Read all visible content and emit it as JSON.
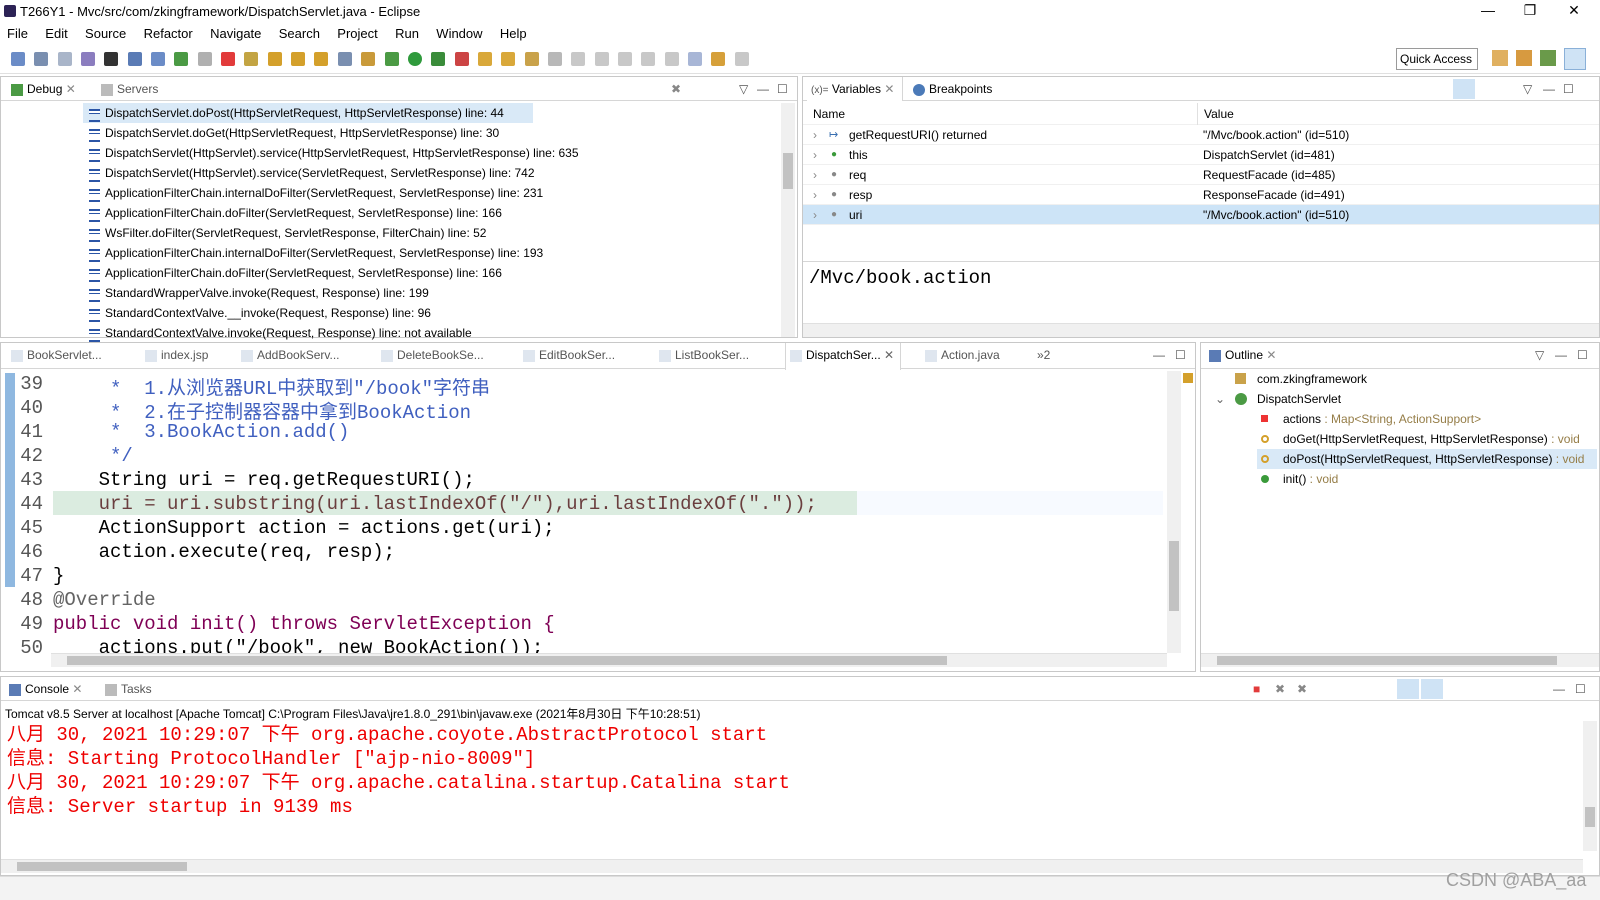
{
  "window": {
    "title": "T266Y1 - Mvc/src/com/zkingframework/DispatchServlet.java - Eclipse"
  },
  "menu": [
    "File",
    "Edit",
    "Source",
    "Refactor",
    "Navigate",
    "Search",
    "Project",
    "Run",
    "Window",
    "Help"
  ],
  "quick_access": "Quick Access",
  "debug": {
    "tabs": [
      "Debug",
      "Servers"
    ],
    "stack": [
      "DispatchServlet.doPost(HttpServletRequest, HttpServletResponse) line: 44",
      "DispatchServlet.doGet(HttpServletRequest, HttpServletResponse) line: 30",
      "DispatchServlet(HttpServlet).service(HttpServletRequest, HttpServletResponse) line: 635",
      "DispatchServlet(HttpServlet).service(ServletRequest, ServletResponse) line: 742",
      "ApplicationFilterChain.internalDoFilter(ServletRequest, ServletResponse) line: 231",
      "ApplicationFilterChain.doFilter(ServletRequest, ServletResponse) line: 166",
      "WsFilter.doFilter(ServletRequest, ServletResponse, FilterChain) line: 52",
      "ApplicationFilterChain.internalDoFilter(ServletRequest, ServletResponse) line: 193",
      "ApplicationFilterChain.doFilter(ServletRequest, ServletResponse) line: 166",
      "StandardWrapperValve.invoke(Request, Response) line: 199",
      "StandardContextValve.__invoke(Request, Response) line: 96",
      "StandardContextValve.invoke(Request, Response) line: not available"
    ]
  },
  "variables": {
    "tabs": [
      "Variables",
      "Breakpoints"
    ],
    "headers": [
      "Name",
      "Value"
    ],
    "rows": [
      {
        "name": "getRequestURI() returned",
        "value": "\"/Mvc/book.action\" (id=510)"
      },
      {
        "name": "this",
        "value": "DispatchServlet  (id=481)"
      },
      {
        "name": "req",
        "value": "RequestFacade  (id=485)"
      },
      {
        "name": "resp",
        "value": "ResponseFacade  (id=491)"
      },
      {
        "name": "uri",
        "value": "\"/Mvc/book.action\" (id=510)"
      }
    ],
    "detail": "/Mvc/book.action"
  },
  "editor": {
    "tabs": [
      "BookServlet...",
      "index.jsp",
      "AddBookServ...",
      "DeleteBookSe...",
      "EditBookSer...",
      "ListBookSer...",
      "DispatchSer...",
      "Action.java"
    ],
    "overflow": "»2",
    "lines": [
      {
        "n": "39",
        "t": "     *  1.从浏览器URL中获取到\"/book\"字符串"
      },
      {
        "n": "40",
        "t": "     *  2.在子控制器容器中拿到BookAction"
      },
      {
        "n": "41",
        "t": "     *  3.BookAction.add()"
      },
      {
        "n": "42",
        "t": "     */"
      },
      {
        "n": "43",
        "t": "    String uri = req.getRequestURI();"
      },
      {
        "n": "44",
        "t": "    uri = uri.substring(uri.lastIndexOf(\"/\"),uri.lastIndexOf(\".\"));"
      },
      {
        "n": "45",
        "t": "    ActionSupport action = actions.get(uri);"
      },
      {
        "n": "46",
        "t": "    action.execute(req, resp);"
      },
      {
        "n": "47",
        "t": "}"
      },
      {
        "n": "48",
        "t": "@Override"
      },
      {
        "n": "49",
        "t": "public void init() throws ServletException {"
      },
      {
        "n": "50",
        "t": "    actions.put(\"/book\", new BookAction());"
      }
    ]
  },
  "outline": {
    "tab": "Outline",
    "items": [
      {
        "label": "com.zkingframework",
        "suffix": ""
      },
      {
        "label": "DispatchServlet",
        "suffix": ""
      },
      {
        "label": "actions",
        "suffix": " : Map<String, ActionSupport>"
      },
      {
        "label": "doGet(HttpServletRequest, HttpServletResponse)",
        "suffix": " : void"
      },
      {
        "label": "doPost(HttpServletRequest, HttpServletResponse)",
        "suffix": " : void"
      },
      {
        "label": "init()",
        "suffix": " : void"
      }
    ]
  },
  "console": {
    "tabs": [
      "Console",
      "Tasks"
    ],
    "header": "Tomcat v8.5 Server at localhost [Apache Tomcat] C:\\Program Files\\Java\\jre1.8.0_291\\bin\\javaw.exe (2021年8月30日 下午10:28:51)",
    "lines": [
      "八月 30, 2021 10:29:07 下午 org.apache.coyote.AbstractProtocol start",
      "信息: Starting ProtocolHandler [\"ajp-nio-8009\"]",
      "八月 30, 2021 10:29:07 下午 org.apache.catalina.startup.Catalina start",
      "信息: Server startup in 9139 ms"
    ]
  },
  "watermark": "CSDN @ABA_aa"
}
